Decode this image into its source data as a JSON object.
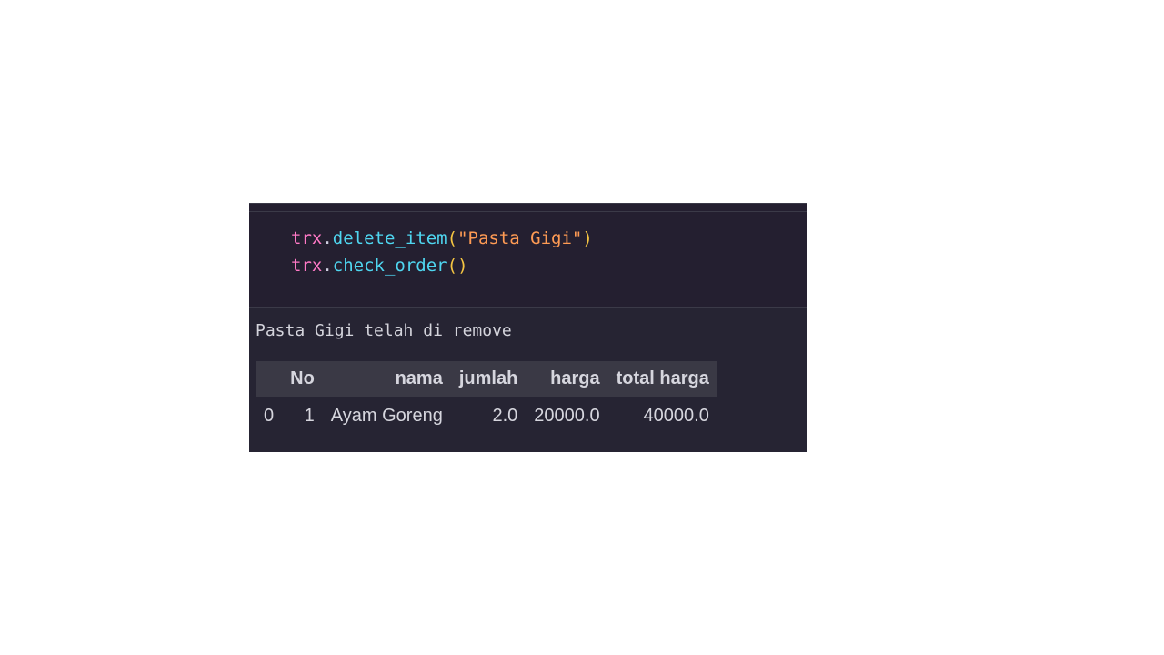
{
  "code_cell": {
    "lines": [
      {
        "var": "trx",
        "dot": ".",
        "fn": "delete_item",
        "open": "(",
        "arg": "\"Pasta Gigi\"",
        "close": ")"
      },
      {
        "var": "trx",
        "dot": ".",
        "fn": "check_order",
        "parens": "()"
      }
    ]
  },
  "output": {
    "stdout": "Pasta Gigi telah di remove",
    "table": {
      "columns": [
        "",
        "No",
        "nama",
        "jumlah",
        "harga",
        "total harga"
      ],
      "rows": [
        [
          "0",
          "1",
          "Ayam Goreng",
          "2.0",
          "20000.0",
          "40000.0"
        ]
      ]
    }
  },
  "colors": {
    "cell_background": "#241f30",
    "output_background": "#262433",
    "header_background": "#3a3945",
    "variable": "#ff79c6",
    "function": "#4fd6f0",
    "paren": "#f5c542",
    "string": "#ff9b54"
  }
}
